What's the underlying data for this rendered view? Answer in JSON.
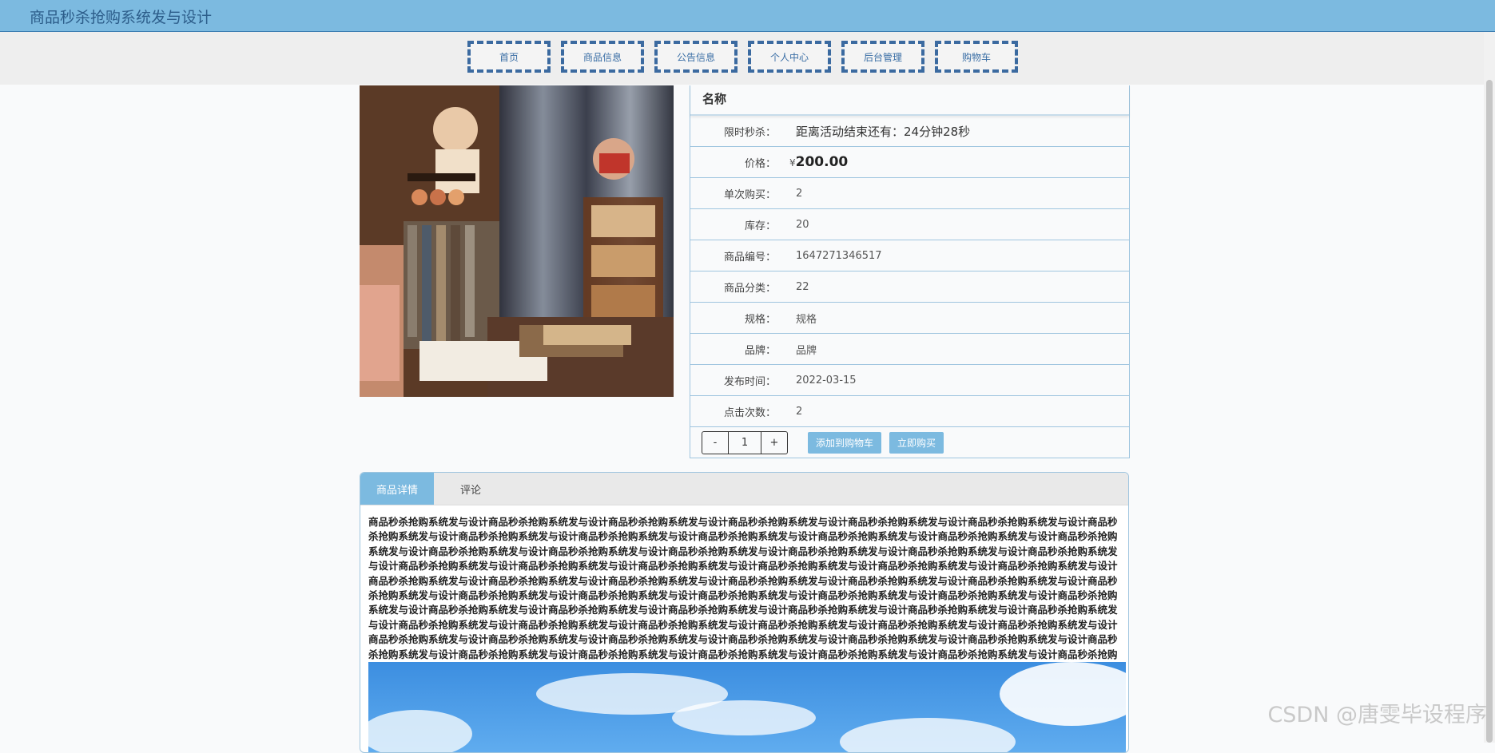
{
  "header": {
    "title": "商品秒杀抢购系统发与设计"
  },
  "nav": [
    {
      "label": "首页"
    },
    {
      "label": "商品信息"
    },
    {
      "label": "公告信息"
    },
    {
      "label": "个人中心"
    },
    {
      "label": "后台管理"
    },
    {
      "label": "购物车"
    }
  ],
  "product": {
    "name": "名称",
    "flash_label": "限时秒杀：",
    "flash_value": "距离活动结束还有：24分钟28秒",
    "price_label": "价格：",
    "price_symbol": "¥",
    "price_value": "200.00",
    "per_purchase_label": "单次购买：",
    "per_purchase_value": "2",
    "stock_label": "库存：",
    "stock_value": "20",
    "code_label": "商品编号：",
    "code_value": "1647271346517",
    "category_label": "商品分类：",
    "category_value": "22",
    "spec_label": "规格：",
    "spec_value": "规格",
    "brand_label": "品牌：",
    "brand_value": "品牌",
    "publish_label": "发布时间：",
    "publish_value": "2022-03-15",
    "clicks_label": "点击次数：",
    "clicks_value": "2"
  },
  "actions": {
    "minus": "-",
    "quantity": "1",
    "plus": "+",
    "add_to_cart": "添加到购物车",
    "buy_now": "立即购买"
  },
  "tabs": [
    {
      "label": "商品详情"
    },
    {
      "label": "评论"
    }
  ],
  "detail_text": "商品秒杀抢购系统发与设计商品秒杀抢购系统发与设计商品秒杀抢购系统发与设计商品秒杀抢购系统发与设计商品秒杀抢购系统发与设计商品秒杀抢购系统发与设计商品秒杀抢购系统发与设计商品秒杀抢购系统发与设计商品秒杀抢购系统发与设计商品秒杀抢购系统发与设计商品秒杀抢购系统发与设计商品秒杀抢购系统发与设计商品秒杀抢购系统发与设计商品秒杀抢购系统发与设计商品秒杀抢购系统发与设计商品秒杀抢购系统发与设计商品秒杀抢购系统发与设计商品秒杀抢购系统发与设计商品秒杀抢购系统发与设计商品秒杀抢购系统发与设计商品秒杀抢购系统发与设计商品秒杀抢购系统发与设计商品秒杀抢购系统发与设计商品秒杀抢购系统发与设计商品秒杀抢购系统发与设计商品秒杀抢购系统发与设计商品秒杀抢购系统发与设计商品秒杀抢购系统发与设计商品秒杀抢购系统发与设计商品秒杀抢购系统发与设计商品秒杀抢购系统发与设计商品秒杀抢购系统发与设计商品秒杀抢购系统发与设计商品秒杀抢购系统发与设计商品秒杀抢购系统发与设计商品秒杀抢购系统发与设计商品秒杀抢购系统发与设计商品秒杀抢购系统发与设计商品秒杀抢购系统发与设计商品秒杀抢购系统发与设计商品秒杀抢购系统发与设计商品秒杀抢购系统发与设计商品秒杀抢购系统发与设计商品秒杀抢购系统发与设计商品秒杀抢购系统发与设计商品秒杀抢购系统发与设计商品秒杀抢购系统发与设计商品秒杀抢购系统发与设计商品秒杀抢购系统发与设计商品秒杀抢购系统发与设计商品秒杀抢购系统发与设计商品秒杀抢购系统发与设计商品秒杀抢购系统发与设计商品秒杀抢购系统发与设计商品秒杀抢购系统发与设计商品秒杀抢购系统发与设计商品秒杀抢购系统发与设计商品秒杀抢购系统发与设计商品秒杀抢购系统发与设计商品秒杀抢购系统发与设计商品秒杀抢购系统发与设计商品秒杀抢购系统发与设计商品秒杀抢购系统发与设计商品秒杀抢购系统发与设计商品秒杀抢购系统发与设计商品秒杀抢购系统发与设计商品秒杀抢购系统发与设计商品秒杀抢购系统发与设计商品秒杀抢购系统发与设计商品秒杀抢购系统发与设计商品秒杀抢购系统发与设计商品秒杀抢购系统发与设计商品秒杀抢购系统发与设计商品秒杀抢购系统发与设计商品秒杀抢购系统发与设计",
  "watermark": "CSDN @唐雯毕设程序",
  "colors": {
    "accent": "#7cbae0",
    "nav_border": "#3b6aa0"
  }
}
